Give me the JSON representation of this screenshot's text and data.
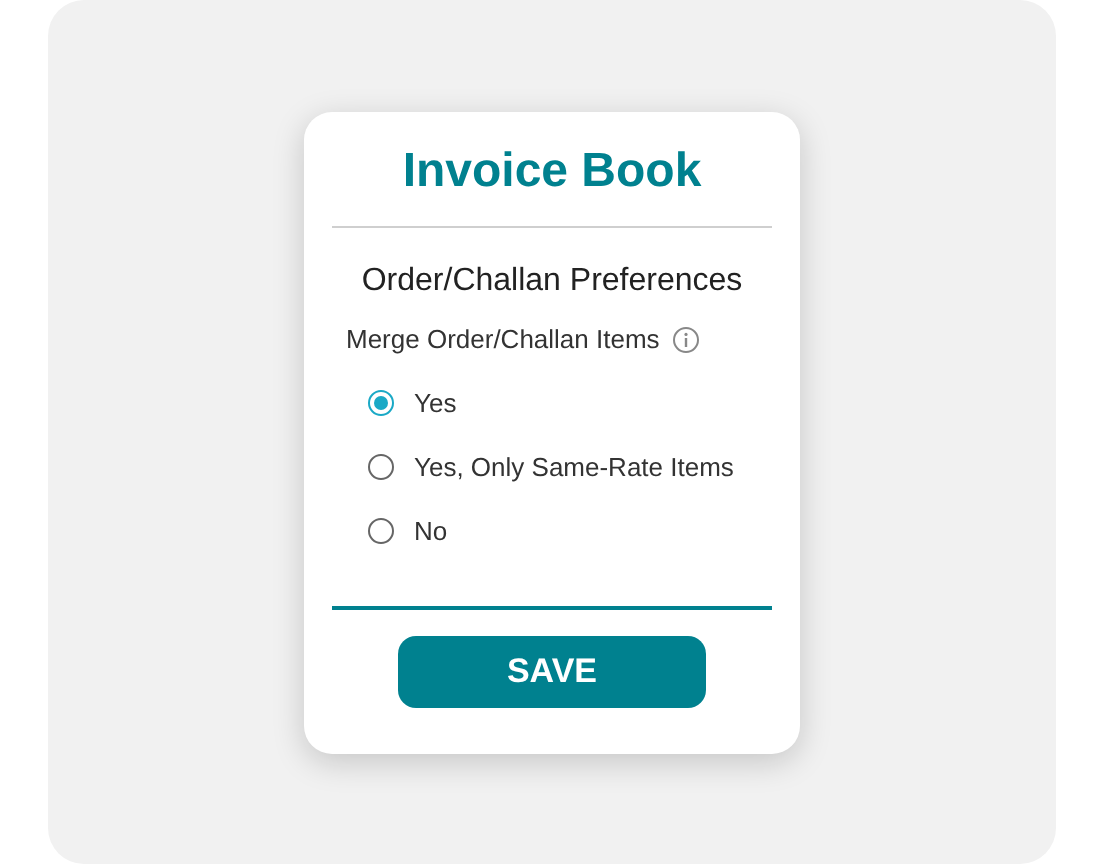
{
  "card": {
    "title": "Invoice Book",
    "heading": "Order/Challan Preferences",
    "question": "Merge Order/Challan Items",
    "options": [
      {
        "label": "Yes",
        "selected": true
      },
      {
        "label": "Yes, Only Same-Rate Items",
        "selected": false
      },
      {
        "label": "No",
        "selected": false
      }
    ],
    "button": "SAVE"
  }
}
